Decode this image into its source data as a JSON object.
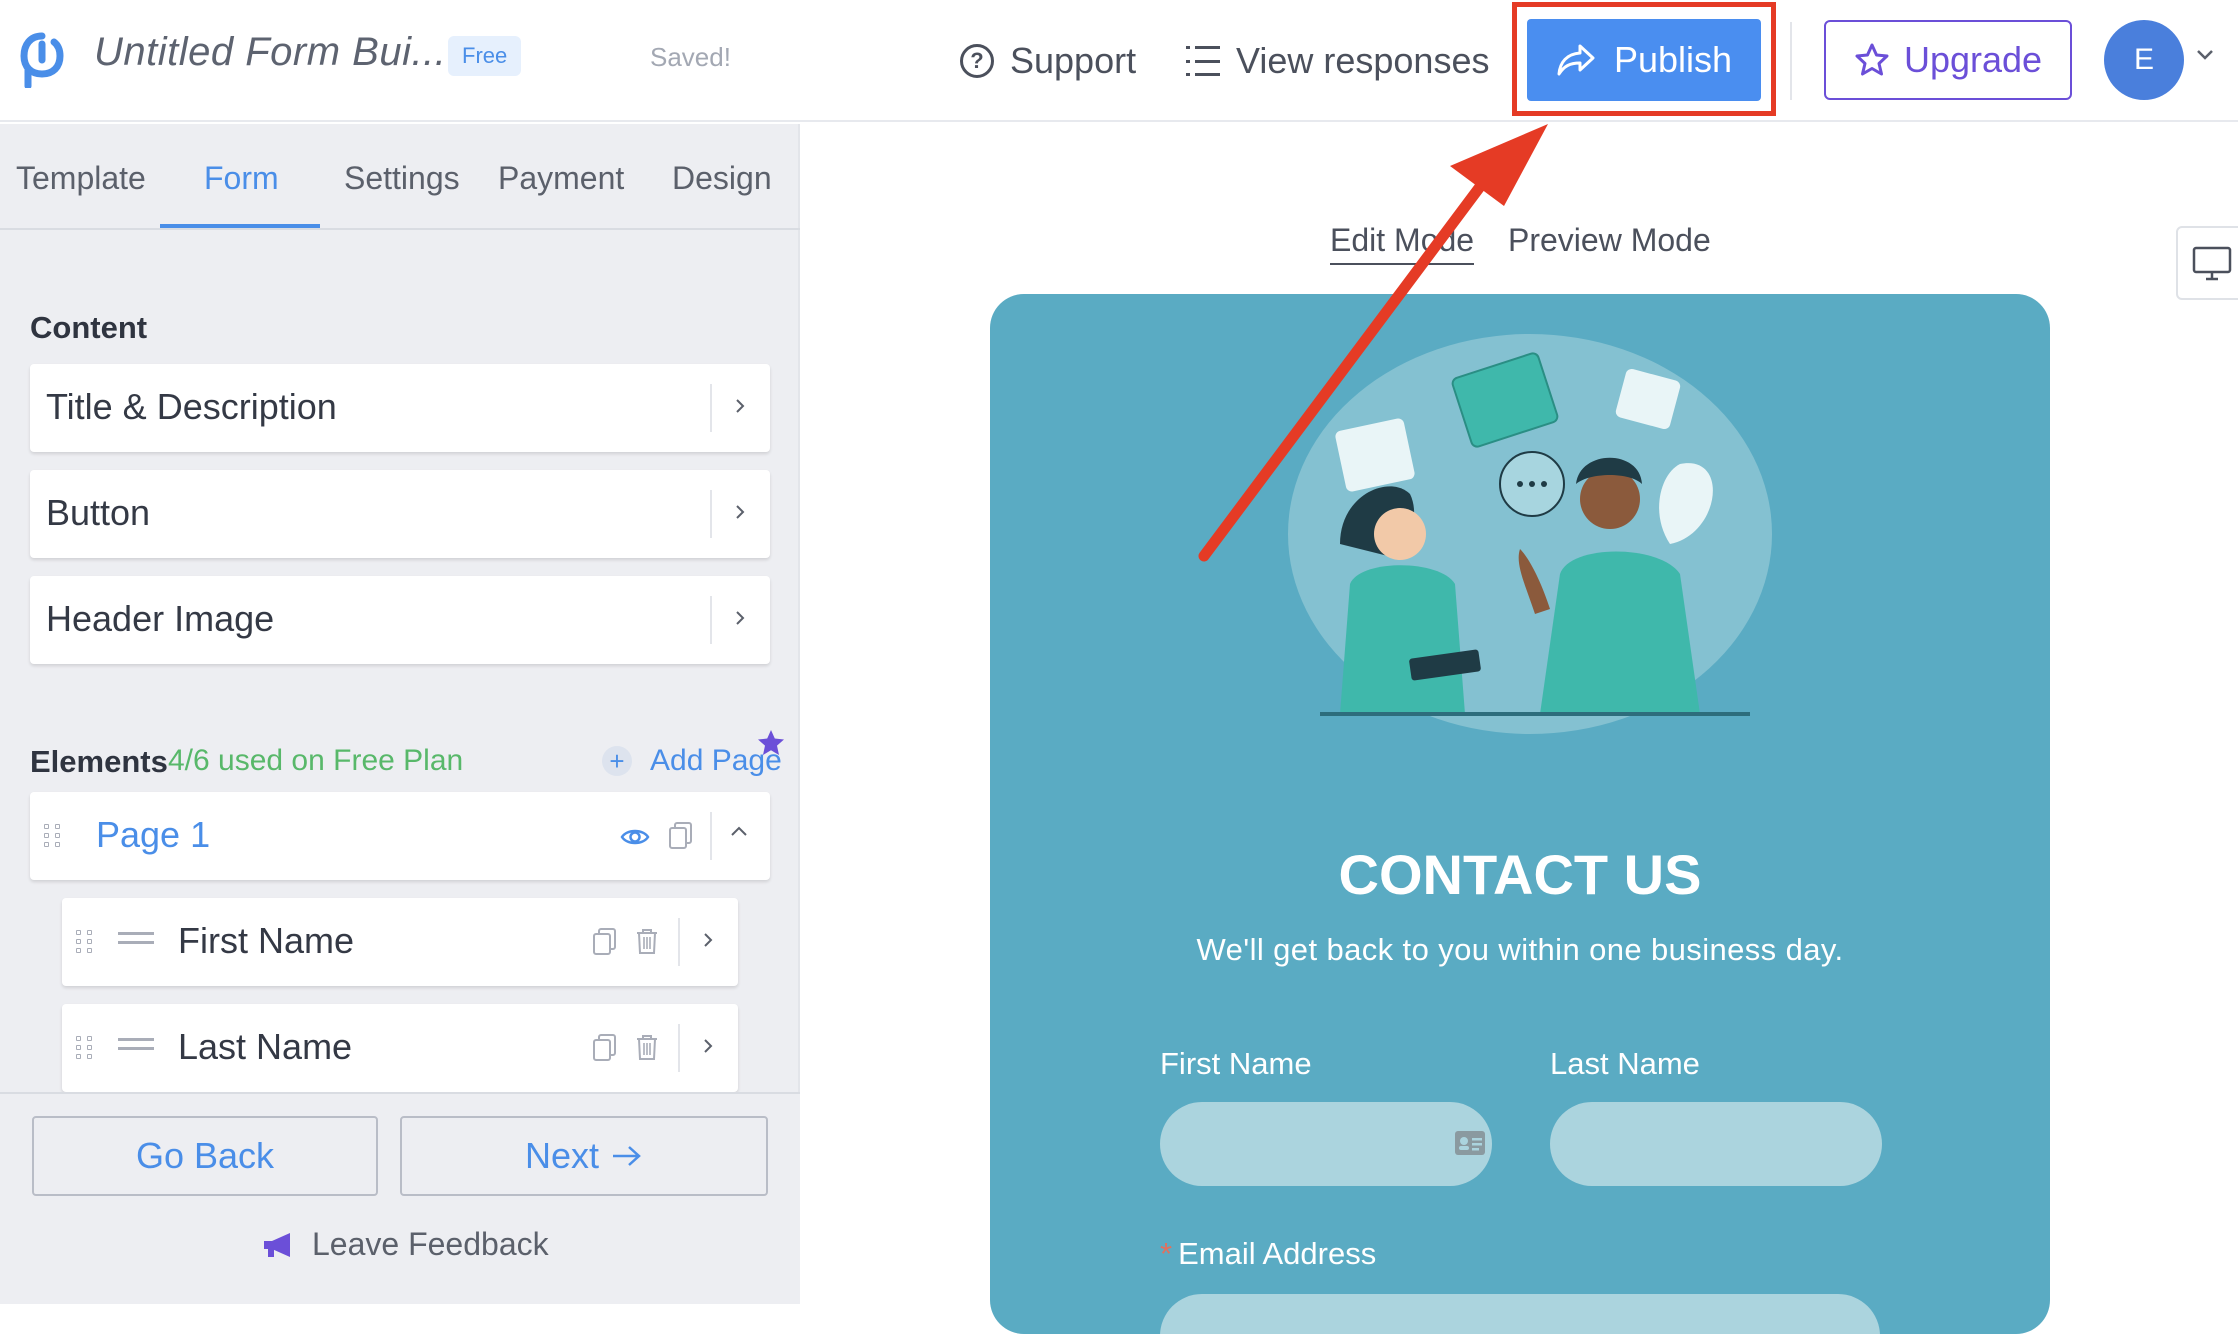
{
  "topbar": {
    "app_title": "Untitled Form Bui...",
    "plan_badge": "Free",
    "save_status": "Saved!",
    "support_label": "Support",
    "view_responses_label": "View responses",
    "publish_label": "Publish",
    "upgrade_label": "Upgrade",
    "avatar_initial": "E"
  },
  "sidebar": {
    "tabs": [
      {
        "label": "Template"
      },
      {
        "label": "Form"
      },
      {
        "label": "Settings"
      },
      {
        "label": "Payment"
      },
      {
        "label": "Design"
      }
    ],
    "active_tab": "Form",
    "content_heading": "Content",
    "content_items": [
      {
        "label": "Title & Description"
      },
      {
        "label": "Button"
      },
      {
        "label": "Header Image"
      }
    ],
    "elements_heading": "Elements",
    "elements_usage": "4/6 used on Free Plan",
    "add_page_label": "Add Page",
    "page": {
      "label": "Page 1"
    },
    "fields": [
      {
        "label": "First Name"
      },
      {
        "label": "Last Name"
      }
    ],
    "go_back_label": "Go Back",
    "next_label": "Next",
    "feedback_label": "Leave Feedback"
  },
  "canvas": {
    "edit_mode_label": "Edit Mode",
    "preview_mode_label": "Preview Mode"
  },
  "form_preview": {
    "title": "CONTACT US",
    "subtitle": "We'll get back to you within one business day.",
    "first_name_label": "First Name",
    "last_name_label": "Last Name",
    "email_label": "Email Address",
    "required_marker": "*"
  },
  "colors": {
    "accent": "#4a8ee8",
    "upgrade": "#6b4fd8",
    "highlight": "#e53b25",
    "form_bg": "#5aabc3",
    "usage_green": "#58b86a"
  }
}
